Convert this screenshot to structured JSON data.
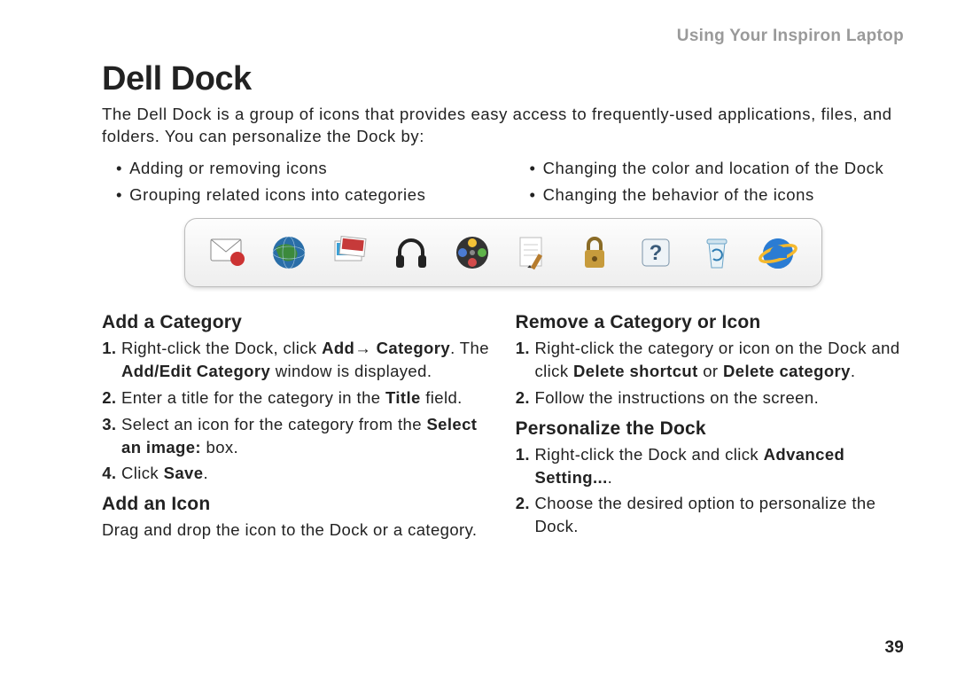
{
  "header": "Using Your Inspiron Laptop",
  "title": "Dell Dock",
  "intro": "The Dell Dock is a group of icons that provides easy access to frequently-used applications, files, and folders. You can personalize the Dock by:",
  "bullets_left": [
    "Adding or removing icons",
    "Grouping related icons into categories"
  ],
  "bullets_right": [
    "Changing the color and location of the Dock",
    "Changing the behavior of the icons"
  ],
  "dock_icons": [
    "mail-icon",
    "globe-icon",
    "photos-icon",
    "headphones-icon",
    "movie-icon",
    "notes-icon",
    "lock-icon",
    "help-icon",
    "recycle-icon",
    "ie-icon"
  ],
  "sections": {
    "add_category": {
      "heading": "Add a Category",
      "steps_html": [
        "Right-click the Dock, click <b>Add→ Category</b>. The <b>Add/Edit Category</b> window is displayed.",
        "Enter a title for the category in the <b>Title</b> field.",
        "Select an icon for the category from the <b>Select an image:</b> box.",
        "Click <b>Save</b>."
      ]
    },
    "add_icon": {
      "heading": "Add an Icon",
      "body": "Drag and drop the icon to the Dock or a category."
    },
    "remove": {
      "heading": "Remove a Category or Icon",
      "steps_html": [
        "Right-click the category or icon on the Dock and click <b>Delete shortcut</b> or <b>Delete category</b>.",
        "Follow the instructions on the screen."
      ]
    },
    "personalize": {
      "heading": "Personalize the Dock",
      "steps_html": [
        "Right-click the Dock and click <b>Advanced Setting...</b>.",
        "Choose the desired option to personalize the Dock."
      ]
    }
  },
  "page_number": "39"
}
